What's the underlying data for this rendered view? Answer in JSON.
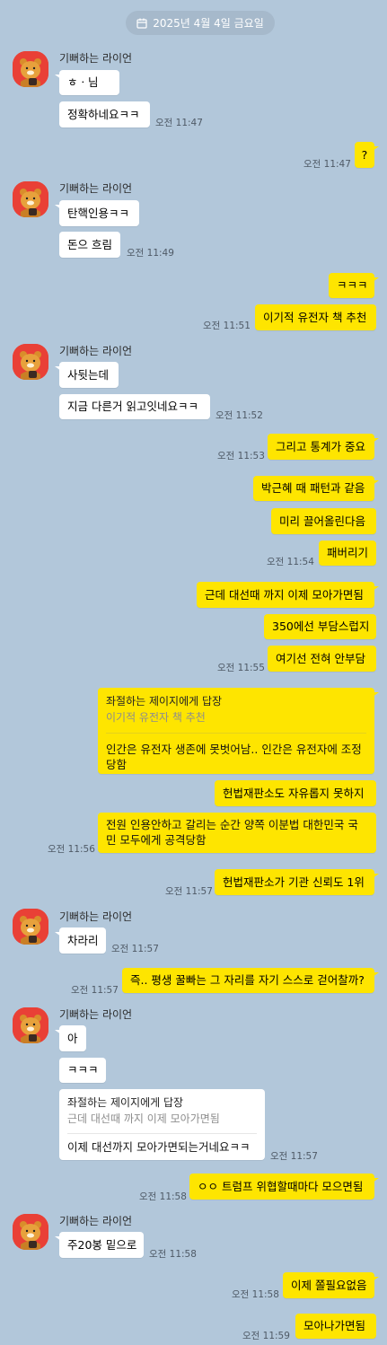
{
  "date": "2025년 4월 4일 금요일",
  "sender_name": "기뻐하는 라이언",
  "colors": {
    "background": "#b2c7da",
    "my_bubble": "#fee500",
    "their_bubble": "#ffffff",
    "avatar": "#e94036"
  },
  "messages": {
    "m1": {
      "text": "ㅎㆍ님"
    },
    "m2": {
      "text": "정확하네요ㅋㅋ",
      "time": "오전 11:47"
    },
    "m3": {
      "text": "?",
      "time": "오전 11:47"
    },
    "m4": {
      "text": "탄핵인용ㅋㅋ"
    },
    "m5": {
      "text": "돈으 흐림",
      "time": "오전 11:49"
    },
    "m6": {
      "text": "ㅋㅋㅋ"
    },
    "m7": {
      "text": "이기적 유전자 책 추천",
      "time": "오전 11:51"
    },
    "m8": {
      "text": "사뒷는데"
    },
    "m9": {
      "text": "지금 다른거 읽고잇네요ㅋㅋ",
      "time": "오전 11:52"
    },
    "m10": {
      "text": "그리고 통계가 중요",
      "time": "오전 11:53"
    },
    "m11": {
      "text": "박근혜 때 패턴과 같음"
    },
    "m12": {
      "text": "미리 끌어올린다음"
    },
    "m13": {
      "text": "패버리기",
      "time": "오전 11:54"
    },
    "m14": {
      "text": "근데 대선때 까지 이제 모아가면됨"
    },
    "m15": {
      "text": "350에선 부담스럽지"
    },
    "m16": {
      "text": "여기선 전혀 안부담",
      "time": "오전 11:55"
    },
    "m17": {
      "reply_to": "좌절하는 제이지에게 답장",
      "quote": "이기적 유전자 책 추천",
      "line1": "인간은 유전자 생존에 못벗어남.. 인간은 유전자에 조정",
      "line2": "당함"
    },
    "m18": {
      "text": "헌법재판소도 자유롭지 못하지"
    },
    "m19": {
      "line1": "전원 인용안하고 갈리는 순간 양쪽 이분법 대한민국 국",
      "line2": "민 모두에게 공격당함",
      "time": "오전 11:56"
    },
    "m20": {
      "text": "헌법재판소가 기관 신뢰도 1위",
      "time": "오전 11:57"
    },
    "m21": {
      "text": "차라리",
      "time": "오전 11:57"
    },
    "m22": {
      "text": "즉.. 평생 꿀빠는 그 자리를 자기 스스로 걷어찰까?",
      "time": "오전 11:57"
    },
    "m23": {
      "text": "아"
    },
    "m24": {
      "text": "ㅋㅋㅋ"
    },
    "m25": {
      "reply_to": "좌절하는 제이지에게 답장",
      "quote": "근데 대선때 까지 이제 모아가면됨",
      "body": "이제 대선까지 모아가면되는거네요ㅋㅋ",
      "time": "오전 11:57"
    },
    "m26": {
      "text": "ㅇㅇ 트럼프 위협할때마다 모으면됨",
      "time": "오전 11:58"
    },
    "m27": {
      "text": "주20봉 밑으로",
      "time": "오전 11:58"
    },
    "m28": {
      "text": "이제 쫄필요없음",
      "time": "오전 11:58"
    },
    "m29": {
      "text": "모아나가면됨",
      "time": "오전 11:59"
    }
  }
}
